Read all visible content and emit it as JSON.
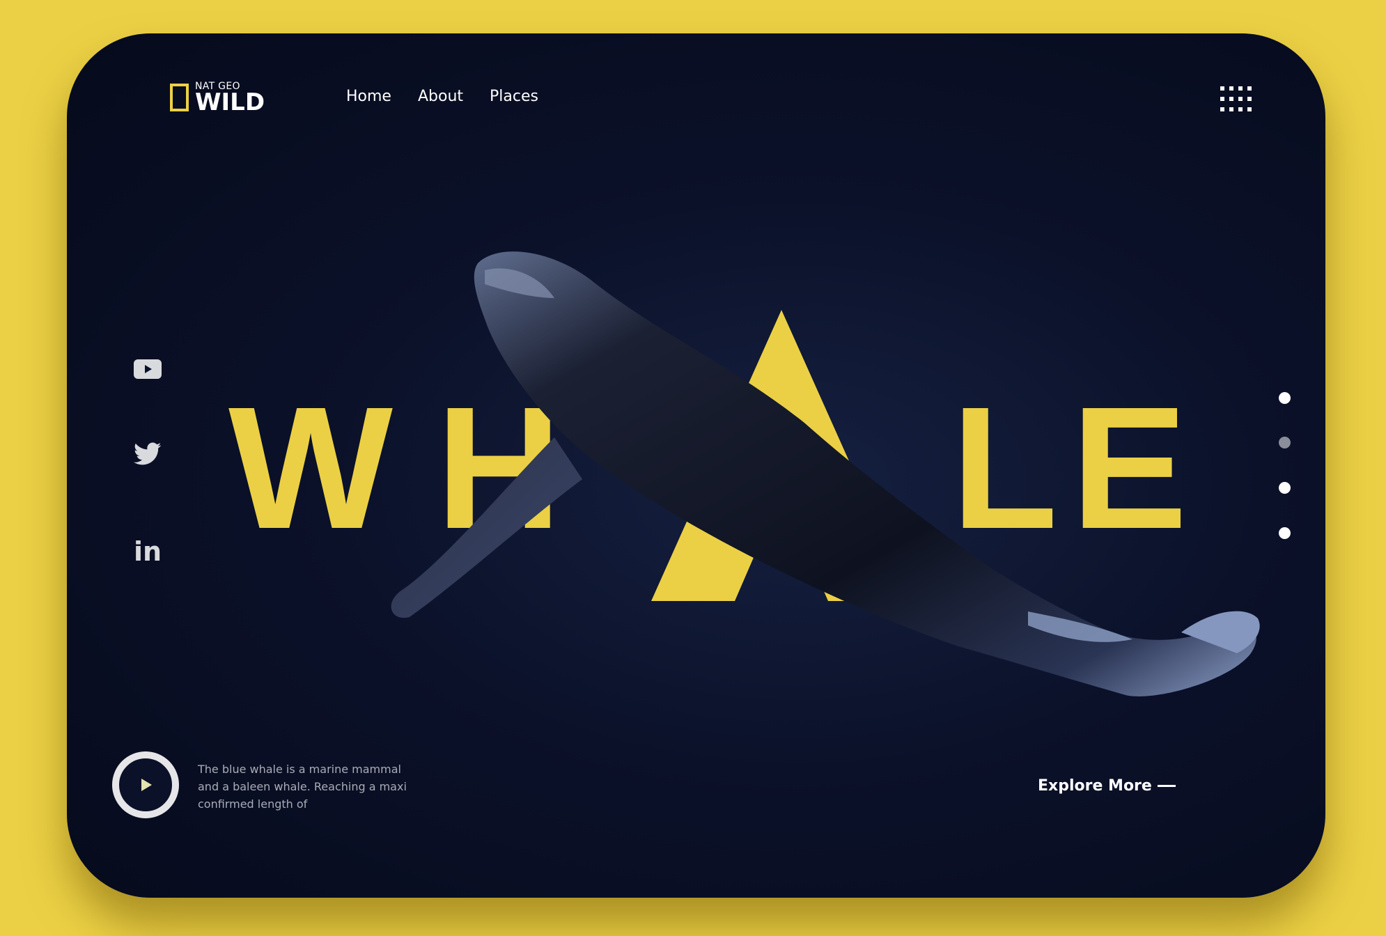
{
  "brand": {
    "small": "NAT GEO",
    "big": "WILD",
    "accent": "#EBD045"
  },
  "nav": {
    "items": [
      "Home",
      "About",
      "Places"
    ]
  },
  "hero": {
    "word": [
      "W",
      "H",
      "A",
      "L",
      "E"
    ]
  },
  "social": {
    "icons": [
      "youtube-icon",
      "twitter-icon",
      "linkedin-icon"
    ],
    "linkedin_text": "in"
  },
  "pager": {
    "count": 4,
    "active_dim_index": 1
  },
  "footer": {
    "description": "The blue whale is a marine mammal and a baleen whale. Reaching a maxi confirmed length of",
    "explore_label": "Explore More"
  },
  "colors": {
    "background": "#EBD045",
    "card": "#0b1129",
    "accent": "#EBD045"
  }
}
